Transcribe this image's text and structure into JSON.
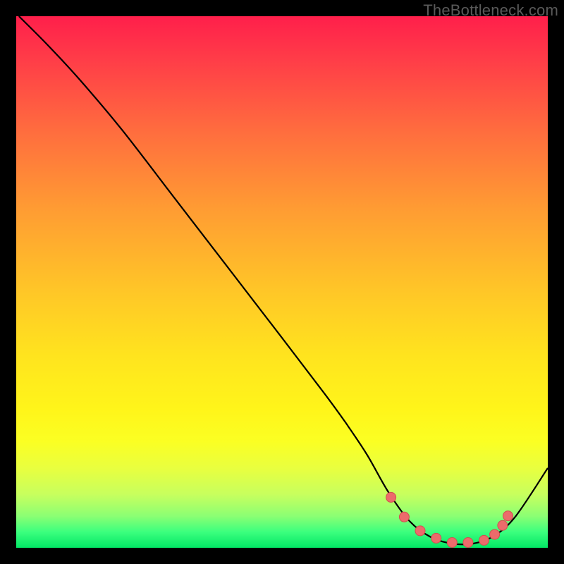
{
  "watermark": "TheBottleneck.com",
  "colors": {
    "frame": "#000000",
    "curve": "#000000",
    "dot_fill": "#ec6b6b",
    "dot_stroke": "#d24f4f"
  },
  "chart_data": {
    "type": "line",
    "title": "",
    "xlabel": "",
    "ylabel": "",
    "xlim": [
      0,
      100
    ],
    "ylim": [
      0,
      100
    ],
    "series": [
      {
        "name": "curve",
        "x": [
          0.5,
          6,
          12,
          20,
          30,
          40,
          50,
          58,
          62,
          66,
          70,
          74,
          78,
          82,
          86,
          90,
          94,
          100
        ],
        "y": [
          100,
          94.5,
          88,
          78.5,
          65.5,
          52.5,
          39.5,
          29,
          23.5,
          17.5,
          10.5,
          5,
          2,
          0.8,
          0.8,
          2.3,
          6,
          15
        ]
      }
    ],
    "dots": {
      "x": [
        70.5,
        73,
        76,
        79,
        82,
        85,
        88,
        90,
        91.5,
        92.5
      ],
      "y": [
        9.5,
        5.8,
        3.2,
        1.8,
        1.0,
        1.0,
        1.4,
        2.5,
        4.2,
        6.0
      ]
    },
    "gradient_stops": [
      {
        "pos": 0,
        "color": "#ff1f4b"
      },
      {
        "pos": 0.22,
        "color": "#ff6e3e"
      },
      {
        "pos": 0.52,
        "color": "#ffc727"
      },
      {
        "pos": 0.8,
        "color": "#fbff23"
      },
      {
        "pos": 0.94,
        "color": "#8cff73"
      },
      {
        "pos": 1.0,
        "color": "#02e765"
      }
    ]
  }
}
